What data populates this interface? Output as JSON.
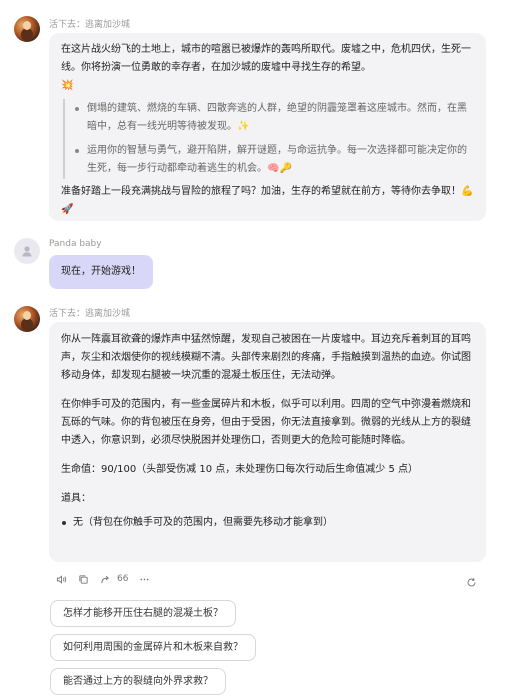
{
  "messages": [
    {
      "sender": "活下去：逃离加沙城",
      "intro": "在这片战火纷飞的土地上，城市的喧嚣已被爆炸的轰鸣所取代。废墟之中，危机四伏，生死一线。你将扮演一位勇敢的幸存者，在加沙城的废墟中寻找生存的希望。",
      "intro_emoji": "💥",
      "quote_items": [
        {
          "text": "倒塌的建筑、燃烧的车辆、四散奔逃的人群，绝望的阴霾笼罩着这座城市。然而，在黑暗中，总有一线光明等待被发现。",
          "emoji": "✨"
        },
        {
          "text": "运用你的智慧与勇气，避开陷阱，解开谜题，与命运抗争。每一次选择都可能决定你的生死，每一步行动都牵动着逃生的机会。",
          "emoji": "🧠🔑"
        }
      ],
      "closing": "准备好踏上一段充满挑战与冒险的旅程了吗？加油，生存的希望就在前方，等待你去争取！",
      "closing_emoji": "💪🚀"
    },
    {
      "sender": "Panda baby",
      "text": "现在，开始游戏！"
    },
    {
      "sender": "活下去：逃离加沙城",
      "paragraphs": [
        "你从一阵震耳欲聋的爆炸声中猛然惊醒，发现自己被困在一片废墟中。耳边充斥着刺耳的耳鸣声，灰尘和浓烟使你的视线模糊不清。头部传来剧烈的疼痛，手指触摸到温热的血迹。你试图移动身体，却发现右腿被一块沉重的混凝土板压住，无法动弹。",
        "在你伸手可及的范围内，有一些金属碎片和木板，似乎可以利用。四周的空气中弥漫着燃烧和瓦砾的气味。你的背包被压在身旁，但由于受困，你无法直接拿到。微弱的光线从上方的裂缝中透入，你意识到，必须尽快脱困并处理伤口，否则更大的危险可能随时降临。",
        "生命值：90/100（头部受伤减 10 点，未处理伤口每次行动后生命值减少 5 点）",
        "道具："
      ],
      "items": [
        "无（背包在你触手可及的范围内，但需要先移动才能拿到）"
      ]
    }
  ],
  "actions": {
    "count": "66",
    "icons": [
      "speaker-icon",
      "copy-icon",
      "share-icon",
      "like-count",
      "more-icon",
      "refresh-icon"
    ]
  },
  "suggestions": [
    "怎样才能移开压住右腿的混凝土板？",
    "如何利用周围的金属碎片和木板来自救？",
    "能否通过上方的裂缝向外界求救？"
  ]
}
